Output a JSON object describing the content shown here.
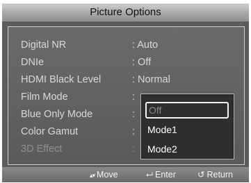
{
  "title": "Picture Options",
  "settings": [
    {
      "label": "Digital NR",
      "value": ": Auto"
    },
    {
      "label": "DNIe",
      "value": ": Off"
    },
    {
      "label": "HDMI Black Level",
      "value": ": Normal"
    },
    {
      "label": "Film Mode",
      "value": ":"
    },
    {
      "label": "Blue Only Mode",
      "value": ":"
    },
    {
      "label": "Color Gamut",
      "value": ":"
    },
    {
      "label": "3D Effect",
      "value": ":"
    }
  ],
  "dropdown": {
    "options": [
      "Off",
      "Mode1",
      "Mode2"
    ],
    "selected": "Off"
  },
  "footer": {
    "move_icon": "▴▾",
    "move_label": "Move",
    "enter_icon": "⮠",
    "enter_label": "Enter",
    "return_icon": "↺",
    "return_label": "Return"
  }
}
